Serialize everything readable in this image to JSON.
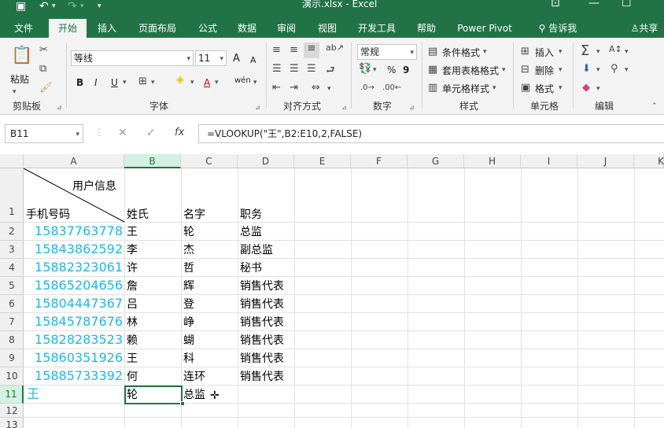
{
  "titlebar": {
    "save_icon": "save-icon",
    "undo_icon": "undo-icon",
    "redo_icon": "redo-icon",
    "customize_icon": "customize-quick-access-icon",
    "window_title": "演示.xlsx  -  Excel",
    "restore_icon": "restore-ribbon-icon",
    "minimize_icon": "minimize-icon",
    "maximize_icon": "maximize-icon"
  },
  "tabs": [
    "文件",
    "开始",
    "插入",
    "页面布局",
    "公式",
    "数据",
    "审阅",
    "视图",
    "开发工具",
    "帮助",
    "Power Pivot"
  ],
  "active_tab": "开始",
  "tell_me": "告诉我",
  "share": "共享",
  "ribbon": {
    "clipboard": {
      "paste": "粘贴",
      "group": "剪贴板"
    },
    "font": {
      "name": "等线",
      "size": "11",
      "grow": "A",
      "shrink": "A",
      "bold": "B",
      "italic": "I",
      "underline": "U",
      "color_a": "A",
      "phonetic": "wén",
      "group": "字体"
    },
    "alignment": {
      "group": "对齐方式"
    },
    "number": {
      "format": "常规",
      "percent": "%",
      "comma": "9",
      "group": "数字"
    },
    "styles": {
      "conditional": "条件格式",
      "table": "套用表格格式",
      "cell_styles": "单元格样式",
      "group": "样式"
    },
    "cells": {
      "insert": "插入",
      "delete": "删除",
      "format": "格式",
      "group": "单元格"
    },
    "editing": {
      "group": "编辑"
    }
  },
  "formula_bar": {
    "name_box": "B11",
    "fx": "fx",
    "formula": "=VLOOKUP(\"王\",B2:E10,2,FALSE)"
  },
  "columns": [
    "A",
    "B",
    "C",
    "D",
    "E",
    "F",
    "G",
    "H",
    "I",
    "J",
    "K"
  ],
  "selected_column": "B",
  "rows": [
    "1",
    "2",
    "3",
    "4",
    "5",
    "6",
    "7",
    "8",
    "9",
    "10",
    "11",
    "12",
    "13"
  ],
  "selected_row": "11",
  "sheet": {
    "a1_top": "用户信息",
    "a1_bottom": "手机号码",
    "headers": [
      "姓氏",
      "名字",
      "职务"
    ],
    "data": [
      {
        "phone": "15837763778",
        "surname": "王",
        "name": "轮",
        "title": "总监"
      },
      {
        "phone": "15843862592",
        "surname": "李",
        "name": "杰",
        "title": "副总监"
      },
      {
        "phone": "15882323061",
        "surname": "许",
        "name": "哲",
        "title": "秘书"
      },
      {
        "phone": "15865204656",
        "surname": "詹",
        "name": "辉",
        "title": "销售代表"
      },
      {
        "phone": "15804447367",
        "surname": "吕",
        "name": "登",
        "title": "销售代表"
      },
      {
        "phone": "15845787676",
        "surname": "林",
        "name": "峥",
        "title": "销售代表"
      },
      {
        "phone": "15828283523",
        "surname": "赖",
        "name": "蝴",
        "title": "销售代表"
      },
      {
        "phone": "15860351926",
        "surname": "王",
        "name": "科",
        "title": "销售代表"
      },
      {
        "phone": "15885733392",
        "surname": "何",
        "name": "连环",
        "title": "销售代表"
      }
    ],
    "row11": {
      "a": "王",
      "b": "轮",
      "c": "总监"
    }
  },
  "colors": {
    "accent": "#217346",
    "phone_text": "#1fb8e8",
    "header_bg": "#f0f0f0"
  }
}
